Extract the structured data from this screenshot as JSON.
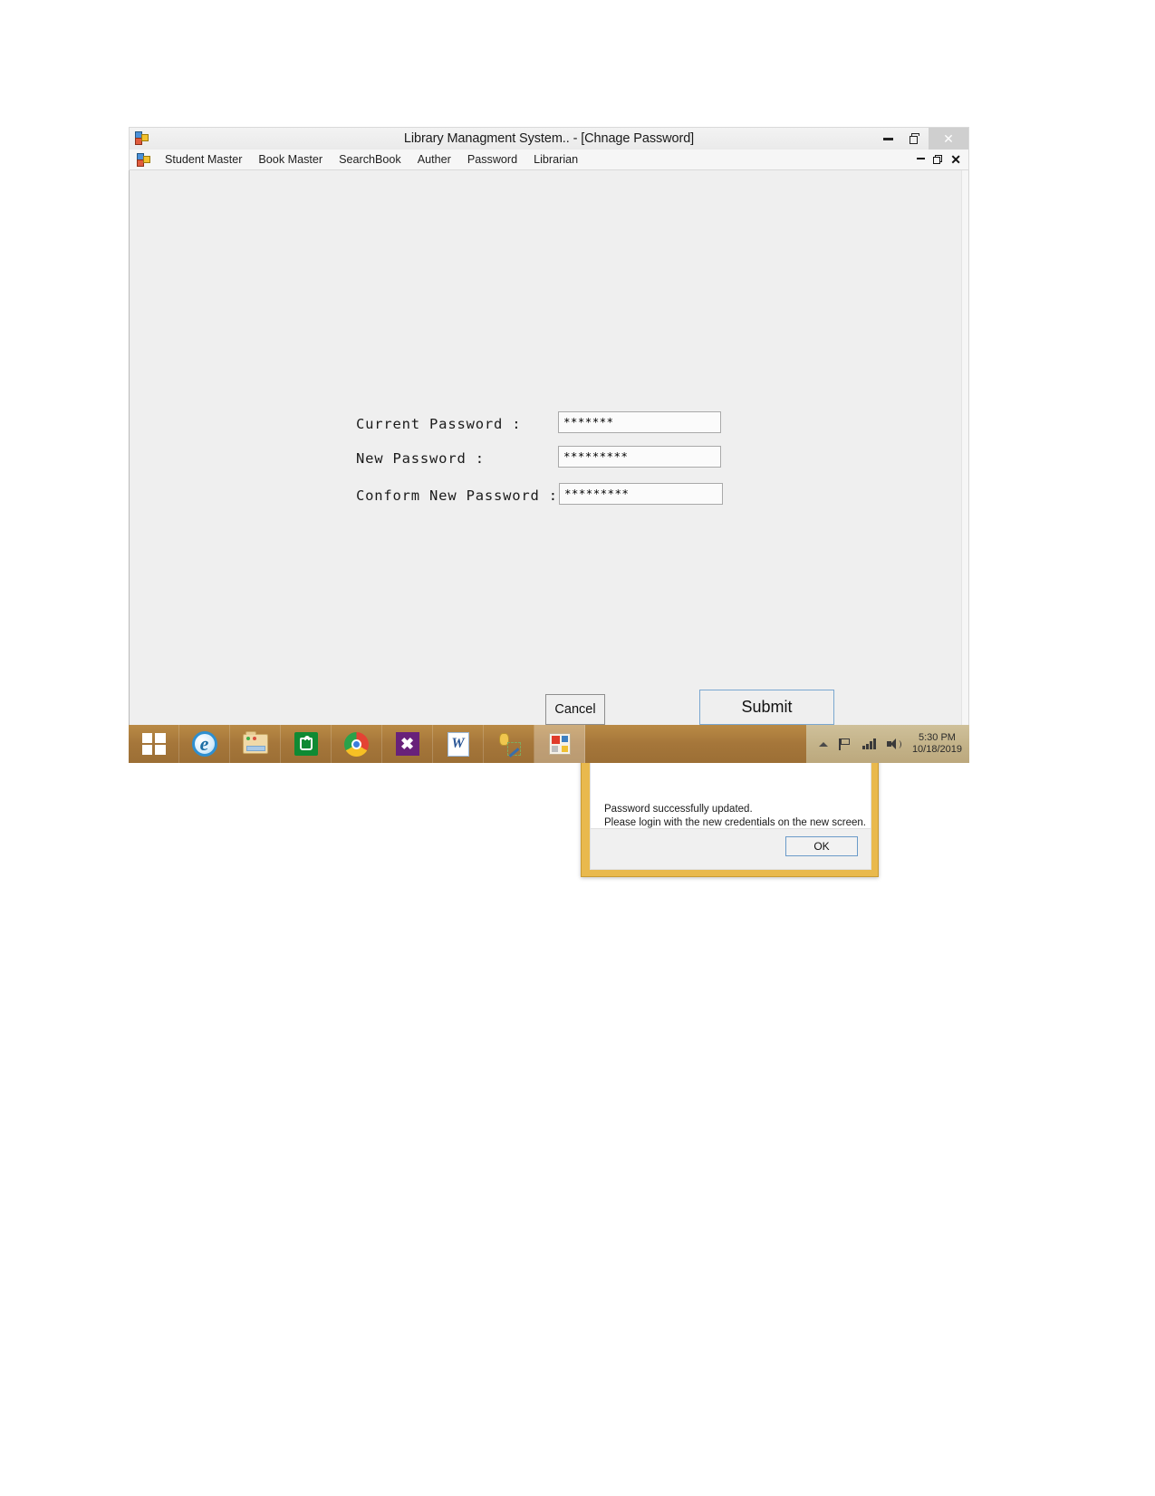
{
  "window": {
    "title": "Library Managment System.. - [Chnage Password]",
    "app_icon": "visual-studio-form-icon",
    "controls": {
      "minimize": "−",
      "maximize": "❐",
      "close": "✕"
    }
  },
  "menu": {
    "icon": "visual-studio-form-icon",
    "items": [
      {
        "label": "Student Master"
      },
      {
        "label": "Book Master"
      },
      {
        "label": "SearchBook"
      },
      {
        "label": "Auther"
      },
      {
        "label": "Password"
      },
      {
        "label": "Librarian"
      }
    ],
    "mdi_controls": {
      "minimize": "−",
      "restore": "❐",
      "close": "✕"
    }
  },
  "form": {
    "fields": [
      {
        "label": "Current Password :",
        "value": "*******",
        "placeholder": ""
      },
      {
        "label": "New Password :",
        "value": "*********",
        "placeholder": ""
      },
      {
        "label": "Conform New Password :",
        "value": "*********",
        "placeholder": ""
      }
    ],
    "cancel_label": "Cancel",
    "submit_label": "Submit"
  },
  "dialog": {
    "title": "",
    "close_label": "✕",
    "message_line1": "Password successfully updated.",
    "message_line2": "Please login with the new credentials on the new screen.",
    "ok_label": "OK",
    "accent_color": "#e9b94d",
    "close_color": "#c0392b"
  },
  "taskbar": {
    "items": [
      {
        "name": "start-button",
        "icon": "windows-logo-icon",
        "active": false
      },
      {
        "name": "internet-explorer",
        "icon": "internet-explorer-icon",
        "active": false
      },
      {
        "name": "file-explorer",
        "icon": "folder-icon",
        "active": false
      },
      {
        "name": "windows-store",
        "icon": "store-bag-icon",
        "active": false
      },
      {
        "name": "google-chrome",
        "icon": "chrome-icon",
        "active": false
      },
      {
        "name": "visual-studio",
        "icon": "visual-studio-icon",
        "active": false
      },
      {
        "name": "microsoft-word",
        "icon": "word-icon",
        "active": false
      },
      {
        "name": "sql-server-tools",
        "icon": "database-tools-icon",
        "active": false
      },
      {
        "name": "library-management-app",
        "icon": "app-window-icon",
        "active": true
      }
    ],
    "tray": {
      "caret": "show-hidden-icons",
      "flag": "action-center-icon",
      "network": "network-signal-icon",
      "volume": "volume-icon",
      "time": "5:30 PM",
      "date": "10/18/2019"
    }
  },
  "colors": {
    "window_bg": "#efefef",
    "titlebar_bg": "#f1f1f1",
    "taskbar_bg": "#a9793a",
    "submit_focus_border": "#7aa7d0"
  }
}
